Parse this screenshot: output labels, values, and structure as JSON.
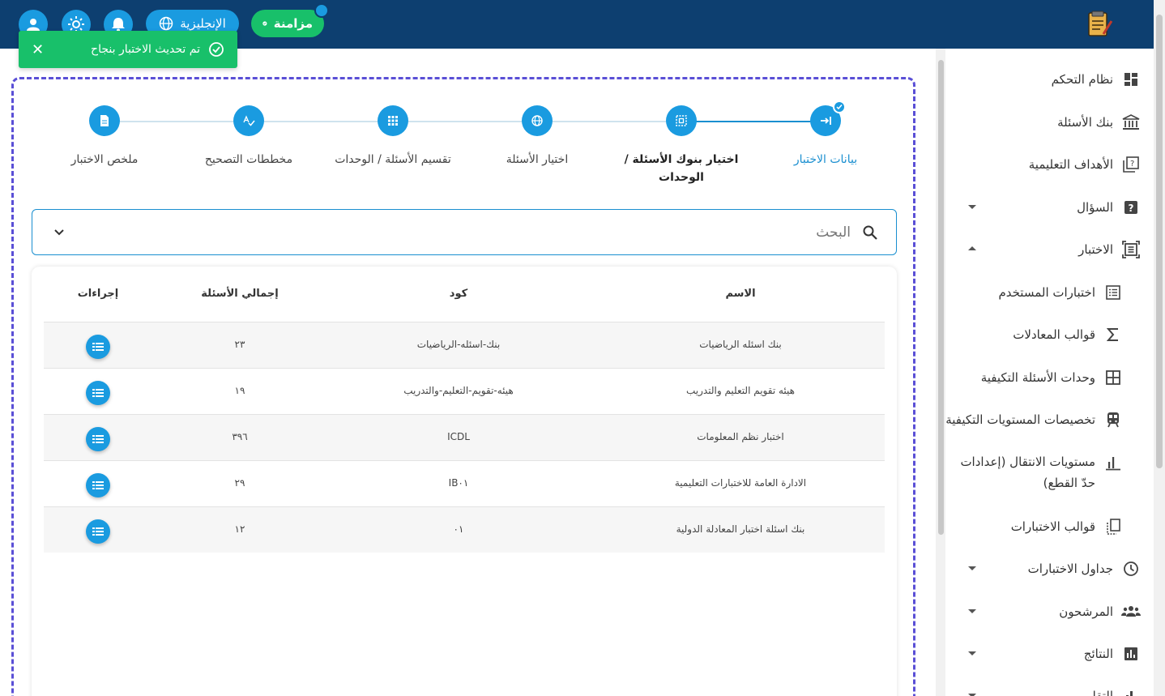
{
  "header": {
    "language_label": "الإنجليزية",
    "sync_label": "مزامنة"
  },
  "toast": {
    "message": "تم تحديث الاختبار بنجاح"
  },
  "sidebar": {
    "items": [
      {
        "label": "نظام التحكم",
        "icon": "dashboard-icon"
      },
      {
        "label": "بنك الأسئلة",
        "icon": "bank-icon"
      },
      {
        "label": "الأهداف التعليمية",
        "icon": "quiz-icon"
      },
      {
        "label": "السؤال",
        "icon": "question-icon"
      },
      {
        "label": "الاختبار",
        "icon": "exam-icon"
      },
      {
        "label": "اختبارات المستخدم",
        "icon": "list-icon"
      },
      {
        "label": "قوالب المعادلات",
        "icon": "sigma-icon"
      },
      {
        "label": "وحدات الأسئلة التكيفية",
        "icon": "grid-icon"
      },
      {
        "label": "تخصيصات المستويات التكيفية",
        "icon": "train-icon"
      },
      {
        "label": "مستويات الانتقال (إعدادات حدّ القطع)",
        "icon": "bar-chart-icon"
      },
      {
        "label": "قوالب الاختبارات",
        "icon": "copy-icon"
      },
      {
        "label": "جداول الاختبارات",
        "icon": "clock-icon"
      },
      {
        "label": "المرشحون",
        "icon": "people-icon"
      },
      {
        "label": "النتائج",
        "icon": "chart-icon"
      },
      {
        "label": "التقارير",
        "icon": "report-icon"
      }
    ]
  },
  "stepper": {
    "steps": [
      {
        "label": "بيانات الاختبار",
        "icon": "login-arrow-icon",
        "state": "done"
      },
      {
        "label": "اختيار بنوك الأسئلة / الوحدات",
        "icon": "dashed-box-icon",
        "state": "current"
      },
      {
        "label": "اختيار الأسئلة",
        "icon": "globe-icon",
        "state": "pending"
      },
      {
        "label": "تقسيم الأسئلة / الوحدات",
        "icon": "apps-icon",
        "state": "pending"
      },
      {
        "label": "مخططات التصحيح",
        "icon": "spellcheck-icon",
        "state": "pending"
      },
      {
        "label": "ملخص الاختبار",
        "icon": "document-icon",
        "state": "pending"
      }
    ]
  },
  "search": {
    "placeholder": "البحث"
  },
  "table": {
    "columns": [
      "الاسم",
      "كود",
      "إجمالي الأسئلة",
      "إجراءات"
    ],
    "rows": [
      {
        "name": "بنك اسئله الرياضيات",
        "code": "بنك-اسئله-الرياضيات",
        "total": "٢٣"
      },
      {
        "name": "هيئه تقويم التعليم والتدريب",
        "code": "هيئه-تقويم-التعليم-والتدريب",
        "total": "١٩"
      },
      {
        "name": "اختبار نظم المعلومات",
        "code": "ICDL",
        "total": "٣٩٦"
      },
      {
        "name": "الادارة العامة للاختبارات التعليمية",
        "code": "IB٠١",
        "total": "٢٩"
      },
      {
        "name": "بنك اسئلة اختبار المعادلة الدولية",
        "code": "٠١",
        "total": "١٢"
      }
    ]
  },
  "colors": {
    "topbar": "#0d3f70",
    "accent": "#1a9be0",
    "success": "#18c06a",
    "dashed_border": "#5a4fd6"
  }
}
